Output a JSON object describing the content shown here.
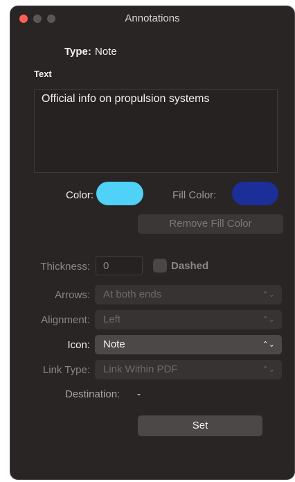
{
  "window": {
    "title": "Annotations"
  },
  "type": {
    "label": "Type:",
    "value": "Note"
  },
  "text": {
    "label": "Text",
    "value": "Official info on propulsion systems"
  },
  "color": {
    "label": "Color:",
    "value_hex": "#4fd1f8"
  },
  "fill_color": {
    "label": "Fill Color:",
    "value_hex": "#1c2e97"
  },
  "remove_fill_button": {
    "label": "Remove Fill Color"
  },
  "thickness": {
    "label": "Thickness:",
    "value": "0"
  },
  "dashed": {
    "label": "Dashed",
    "checked": false
  },
  "arrows": {
    "label": "Arrows:",
    "value": "At both ends"
  },
  "alignment": {
    "label": "Alignment:",
    "value": "Left"
  },
  "icon": {
    "label": "Icon:",
    "value": "Note"
  },
  "link_type": {
    "label": "Link Type:",
    "value": "Link Within PDF"
  },
  "destination": {
    "label": "Destination:",
    "value": "-"
  },
  "set_button": {
    "label": "Set"
  },
  "icons": {
    "chevron": "chevron-up-down-icon"
  }
}
